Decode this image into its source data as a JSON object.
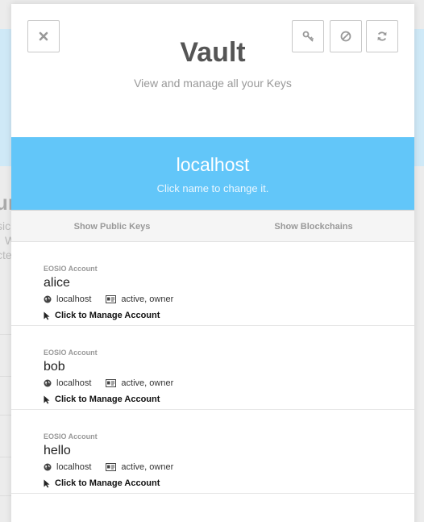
{
  "background": {
    "fragment_big": "ur",
    "fragment_1": "sic",
    "fragment_2": "W",
    "fragment_3": "cte"
  },
  "modal": {
    "title": "Vault",
    "subtitle": "View and manage all your Keys",
    "buttons": {
      "close_icon": "close-icon",
      "key_icon": "key-icon",
      "block_icon": "block-icon",
      "refresh_icon": "refresh-icon"
    }
  },
  "network": {
    "name": "localhost",
    "hint": "Click name to change it."
  },
  "toggles": {
    "public_keys": "Show Public Keys",
    "blockchains": "Show Blockchains"
  },
  "accounts": [
    {
      "type": "EOSIO Account",
      "name": "alice",
      "network": "localhost",
      "permissions": "active, owner",
      "action": "Click to Manage Account"
    },
    {
      "type": "EOSIO Account",
      "name": "bob",
      "network": "localhost",
      "permissions": "active, owner",
      "action": "Click to Manage Account"
    },
    {
      "type": "EOSIO Account",
      "name": "hello",
      "network": "localhost",
      "permissions": "active, owner",
      "action": "Click to Manage Account"
    }
  ],
  "colors": {
    "banner": "#62c6f9",
    "title": "#555555",
    "muted": "#999999"
  }
}
